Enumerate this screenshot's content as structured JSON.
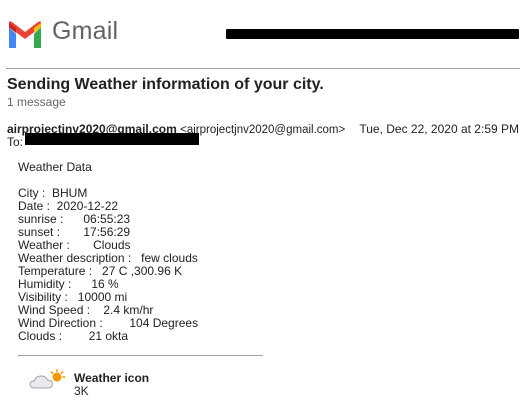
{
  "header": {
    "app_name": "Gmail"
  },
  "message": {
    "subject": "Sending Weather information of your city.",
    "count": "1 message",
    "sender_name": "airprojectjnv2020@gmail.com",
    "sender_addr": "<airprojectjnv2020@gmail.com>",
    "date": "Tue, Dec 22, 2020 at 2:59 PM",
    "to_label": "To:"
  },
  "body": {
    "heading": "Weather Data",
    "lines": [
      "City :  BHUM",
      "Date :  2020-12-22",
      "sunrise :      06:55:23",
      "sunset :       17:56:29",
      "Weather :       Clouds",
      "Weather description :   few clouds",
      "Temperature :   27 C ,300.96 K",
      "Humidity :      16 %",
      "Visibility :   10000 mi",
      "Wind Speed :    2.4 km/hr",
      "Wind Direction :        104 Degrees",
      "Clouds :        21 okta"
    ]
  },
  "attachment": {
    "title": "Weather icon",
    "size": "3K",
    "icon": "cloud-sun-icon"
  },
  "colors": {
    "gmail_red": "#ea4335",
    "gmail_blue": "#4285f4",
    "gmail_green": "#34a853",
    "gmail_yellow": "#fbbc04",
    "wordmark_gray": "#5f6368"
  }
}
